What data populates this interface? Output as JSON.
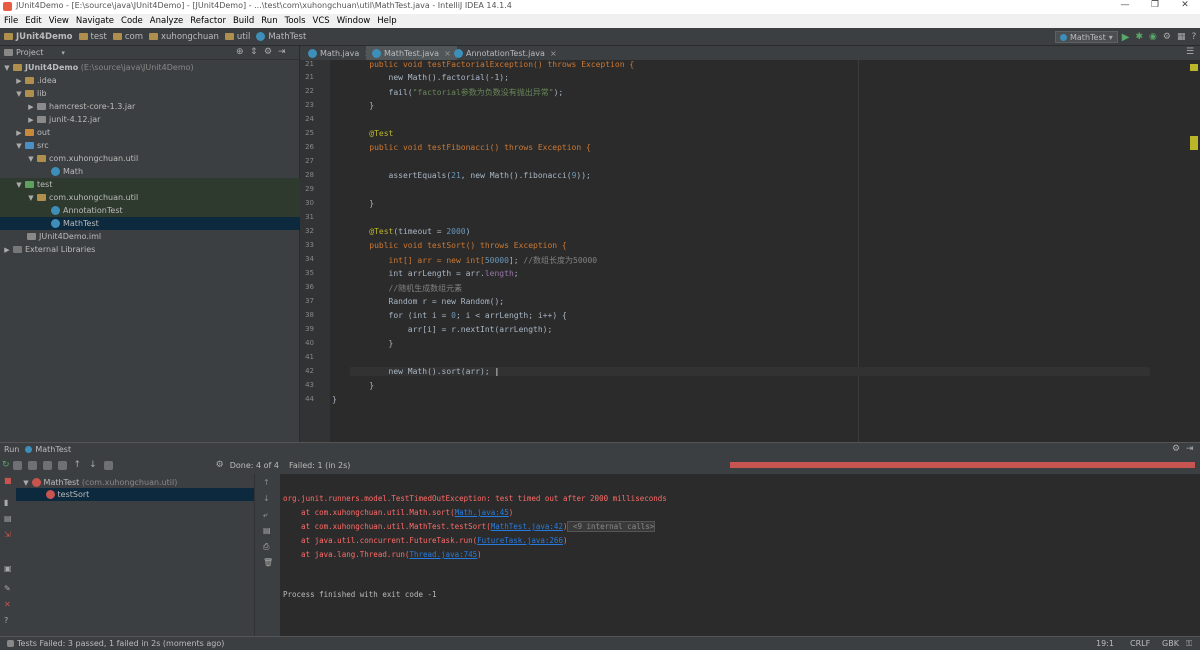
{
  "window": {
    "title": "JUnit4Demo - [E:\\source\\java\\JUnit4Demo] - [JUnit4Demo] - ...\\test\\com\\xuhongchuan\\util\\MathTest.java - IntelliJ IDEA 14.1.4"
  },
  "menu": [
    "File",
    "Edit",
    "View",
    "Navigate",
    "Code",
    "Analyze",
    "Refactor",
    "Build",
    "Run",
    "Tools",
    "VCS",
    "Window",
    "Help"
  ],
  "breadcrumbs": [
    "JUnit4Demo",
    "test",
    "com",
    "xuhongchuan",
    "util",
    "MathTest"
  ],
  "run_config": "MathTest",
  "project": {
    "header": "Project",
    "tree": [
      {
        "label": "JUnit4Demo",
        "extra": "(E:\\source\\java\\JUnit4Demo)"
      },
      {
        "label": ".idea"
      },
      {
        "label": "lib"
      },
      {
        "label": "hamcrest-core-1.3.jar"
      },
      {
        "label": "junit-4.12.jar"
      },
      {
        "label": "out"
      },
      {
        "label": "src"
      },
      {
        "label": "com.xuhongchuan.util"
      },
      {
        "label": "Math"
      },
      {
        "label": "test"
      },
      {
        "label": "com.xuhongchuan.util"
      },
      {
        "label": "AnnotationTest"
      },
      {
        "label": "MathTest"
      },
      {
        "label": "JUnit4Demo.iml"
      },
      {
        "label": "External Libraries"
      }
    ]
  },
  "tabs": [
    "Math.java",
    "MathTest.java",
    "AnnotationTest.java"
  ],
  "code": {
    "line_numbers": [
      "21",
      "21",
      "22",
      "23",
      "24",
      "25",
      "26",
      "27",
      "28",
      "29",
      "30",
      "31",
      "32",
      "33",
      "34",
      "35",
      "36",
      "37",
      "38",
      "39",
      "40",
      "41",
      "42",
      "43",
      "44"
    ],
    "l20": "    public void testFactorialException() throws Exception {",
    "l21": "        new Math().factorial(-1);",
    "l22a": "        fail(",
    "l22b": "\"factorial参数为负数没有抛出异常\"",
    "l22c": ");",
    "l23": "    }",
    "l25": "    @Test",
    "l26": "    public void testFibonacci() throws Exception {",
    "l28a": "        assertEquals(",
    "l28b": "21",
    "l28c": ", new Math().fibonacci(",
    "l28d": "9",
    "l28e": "));",
    "l30": "    }",
    "l32a": "    @Test",
    "l32b": "(timeout = ",
    "l32c": "2000",
    "l32d": ")",
    "l33": "    public void testSort() throws Exception {",
    "l34a": "        int[] arr = new int[",
    "l34b": "50000",
    "l34c": "]; ",
    "l34d": "//数组长度为50000",
    "l35a": "        int arrLength = arr.",
    "l35b": "length",
    "l35c": ";",
    "l36": "        //随机生成数组元素",
    "l37": "        Random r = new Random();",
    "l38a": "        for (int i = ",
    "l38b": "0",
    "l38c": "; i < arrLength; i++) {",
    "l39": "            arr[i] = r.nextInt(arrLength);",
    "l40": "        }",
    "l42": "        new Math().sort(arr);",
    "l43": "    }",
    "l44": "}"
  },
  "run": {
    "label": "Run",
    "config": "MathTest",
    "status_done": "Done: 4 of 4",
    "status_failed": "Failed: 1 (in 2s)",
    "tree_root": "MathTest",
    "tree_root_pkg": "(com.xuhongchuan.util)",
    "tree_child": "testSort",
    "console": {
      "l1": "org.junit.runners.model.TestTimedOutException: test timed out after 2000 milliseconds",
      "l2a": "    at com.xuhongchuan.util.Math.sort(",
      "l2b": "Math.java:45",
      "l2c": ")",
      "l3a": "    at com.xuhongchuan.util.MathTest.testSort(",
      "l3b": "MathTest.java:42",
      "l3c": ")",
      "l3d": " <9 internal calls>",
      "l4a": "    at java.util.concurrent.FutureTask.run(",
      "l4b": "FutureTask.java:266",
      "l4c": ")",
      "l5a": "    at java.lang.Thread.run(",
      "l5b": "Thread.java:745",
      "l5c": ")",
      "l6": "Process finished with exit code -1"
    }
  },
  "status": {
    "left": "Tests Failed: 3 passed, 1 failed in 2s (moments ago)",
    "pos": "19:1",
    "eol": "CRLF",
    "enc": "GBK"
  },
  "colors": {
    "fail_bar": "#c75450",
    "selection": "#0d293e"
  }
}
